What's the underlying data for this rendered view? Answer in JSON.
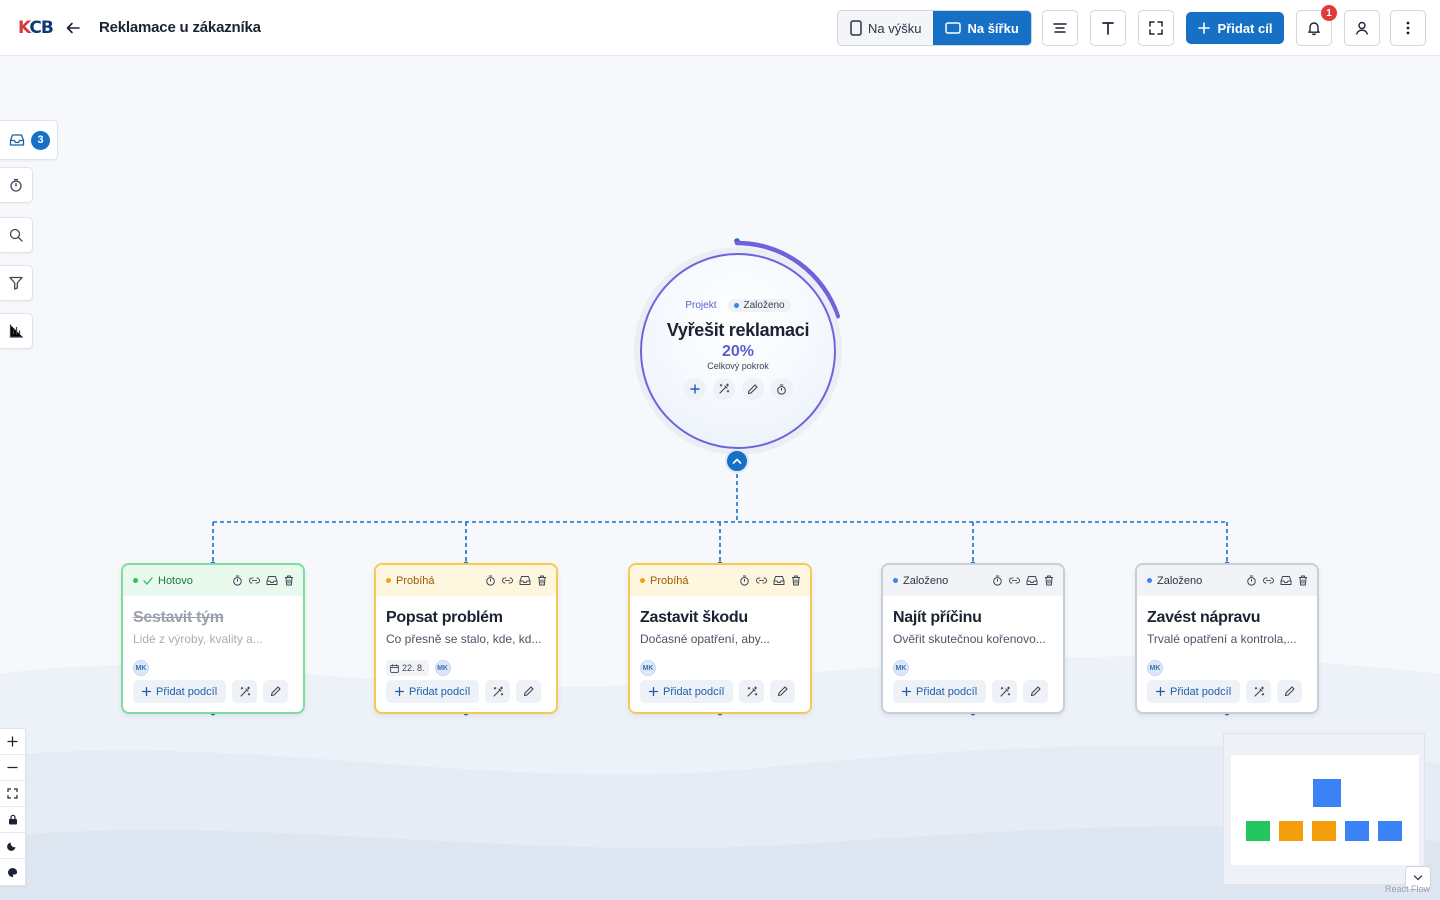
{
  "header": {
    "logo_text_k": "K",
    "logo_text_cb": "CB",
    "title": "Reklamace u zákazníka",
    "orientation": {
      "portrait_label": "Na výšku",
      "landscape_label": "Na šířku",
      "active": "landscape"
    },
    "add_goal_label": "Přidat cíl",
    "notifications_count": "1",
    "colors": {
      "primary": "#1670c5",
      "badge": "#e03a3a"
    }
  },
  "sidebar": {
    "inbox_count": "3",
    "buttons": [
      "inbox-icon",
      "timer-icon",
      "search-icon",
      "filter-icon",
      "chart-icon"
    ]
  },
  "root": {
    "type_label": "Projekt",
    "status_label": "Založeno",
    "title": "Vyřešit reklamaci",
    "progress_text": "20%",
    "progress_value": 0.2,
    "progress_label": "Celkový pokrok",
    "colors": {
      "ring": "#6f63dc"
    }
  },
  "cards": [
    {
      "status": "Hotovo",
      "state": "done",
      "title": "Sestavit tým",
      "desc": "Lidé z výroby, kvality a...",
      "date": "",
      "avatar": "MK",
      "add_label": "Přidat podcíl"
    },
    {
      "status": "Probíhá",
      "state": "progress",
      "title": "Popsat problém",
      "desc": "Co přesně se stalo, kde, kd...",
      "date": "22. 8.",
      "avatar": "MK",
      "add_label": "Přidat podcíl"
    },
    {
      "status": "Probíhá",
      "state": "progress",
      "title": "Zastavit škodu",
      "desc": "Dočasné opatření, aby...",
      "date": "",
      "avatar": "MK",
      "add_label": "Přidat podcíl"
    },
    {
      "status": "Založeno",
      "state": "new",
      "title": "Najít příčinu",
      "desc": "Ověřit skutečnou kořenovo...",
      "date": "",
      "avatar": "MK",
      "add_label": "Přidat podcíl"
    },
    {
      "status": "Založeno",
      "state": "new",
      "title": "Zavést nápravu",
      "desc": "Trvalé opatření a kontrola,...",
      "date": "",
      "avatar": "MK",
      "add_label": "Přidat podcíl"
    }
  ],
  "status_colors": {
    "done": "#2fbf5b",
    "progress": "#f2a20c",
    "new": "#3b82f6"
  },
  "minimap": {
    "colors": {
      "root": "#3b82f6",
      "done": "#22c55e",
      "progress": "#f59e0b",
      "new": "#3b82f6"
    }
  },
  "footer": {
    "attribution": "React Flow"
  }
}
